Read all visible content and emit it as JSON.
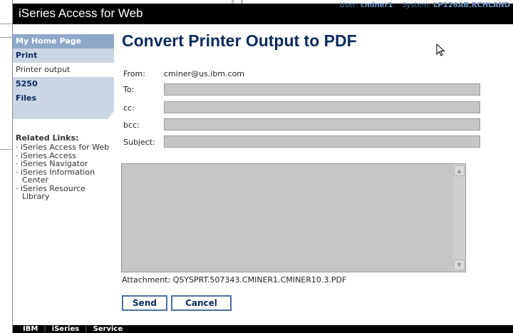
{
  "header": {
    "title": "iSeries Access for Web",
    "user_label": "User:",
    "user": "cminer1",
    "system_label": "System:",
    "system": "LP126AB.RCHLAND"
  },
  "nav": {
    "home": "My Home Page",
    "print": "Print",
    "printer_output": "Printer output",
    "item_5250": "5250",
    "files": "Files"
  },
  "related": {
    "title": "Related Links:",
    "links": [
      "iSeries Access for Web",
      "iSeries Access",
      "iSeries Navigator",
      "iSeries Information Center",
      "iSeries Resource Library"
    ]
  },
  "page": {
    "title": "Convert Printer Output to PDF"
  },
  "form": {
    "from_label": "From:",
    "from_value": "cminer@us.ibm.com",
    "to_label": "To:",
    "cc_label": "cc:",
    "bcc_label": "bcc:",
    "subject_label": "Subject:",
    "to_value": "",
    "cc_value": "",
    "bcc_value": "",
    "subject_value": "",
    "message_value": "",
    "attachment_label": "Attachment:",
    "attachment_value": "QSYSPRT.507343.CMINER1.CMINER10.3.PDF",
    "send_label": "Send",
    "cancel_label": "Cancel"
  },
  "footer": {
    "items": [
      "IBM",
      "iSeries",
      "Service"
    ]
  },
  "colors": {
    "header_bg": "#000000",
    "title_color": "#0b2a5c",
    "nav_bg": "#cbd6e5",
    "nav_active_bg": "#8fa7c8",
    "field_bg": "#c6c6c6"
  }
}
